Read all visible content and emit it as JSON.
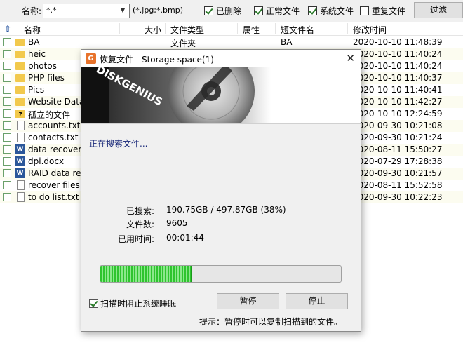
{
  "toolbar": {
    "name_label": "名称:",
    "name_value": "*.*",
    "ext_hint": "(*.jpg;*.bmp)",
    "filters": [
      {
        "label": "已删除",
        "checked": true
      },
      {
        "label": "正常文件",
        "checked": true
      },
      {
        "label": "系统文件",
        "checked": true
      },
      {
        "label": "重复文件",
        "checked": false
      }
    ],
    "filter_button": "过滤"
  },
  "columns": [
    "名称",
    "大小",
    "文件类型",
    "属性",
    "短文件名",
    "修改时间"
  ],
  "files": [
    {
      "name": "BA",
      "type": "文件夹",
      "short": "BA",
      "time": "2020-10-10 11:48:39",
      "icon": "folder-icon"
    },
    {
      "name": "heic",
      "type": "",
      "short": "",
      "time": "2020-10-10 11:40:24",
      "icon": "folder-icon"
    },
    {
      "name": "photos",
      "type": "",
      "short": "",
      "time": "2020-10-10 11:40:24",
      "icon": "folder-icon"
    },
    {
      "name": "PHP files",
      "type": "",
      "short": "",
      "time": "2020-10-10 11:40:37",
      "icon": "folder-icon"
    },
    {
      "name": "Pics",
      "type": "",
      "short": "",
      "time": "2020-10-10 11:40:41",
      "icon": "folder-icon"
    },
    {
      "name": "Website Data",
      "type": "",
      "short": "",
      "time": "2020-10-10 11:42:27",
      "icon": "folder-icon"
    },
    {
      "name": "孤立的文件",
      "type": "",
      "short": "",
      "time": "2020-10-10 12:24:59",
      "icon": "orphan-folder-icon"
    },
    {
      "name": "accounts.txt",
      "type": "",
      "short": "",
      "time": "2020-09-30 10:21:08",
      "icon": "text-file-icon"
    },
    {
      "name": "contacts.txt",
      "type": "",
      "short": "",
      "time": "2020-09-30 10:21:24",
      "icon": "text-file-icon"
    },
    {
      "name": "data recovery",
      "type": "",
      "short": "",
      "time": "2020-08-11 15:50:27",
      "icon": "word-file-icon"
    },
    {
      "name": "dpi.docx",
      "type": "",
      "short": "",
      "time": "2020-07-29 17:28:38",
      "icon": "word-file-icon"
    },
    {
      "name": "RAID data re",
      "type": "",
      "short": "",
      "time": "2020-09-30 10:21:57",
      "icon": "word-file-icon"
    },
    {
      "name": "recover files",
      "type": "",
      "short": "",
      "time": "2020-08-11 15:52:58",
      "icon": "text-file-icon"
    },
    {
      "name": "to do list.txt",
      "type": "",
      "short": "",
      "time": "2020-09-30 10:22:23",
      "icon": "text-file-icon"
    }
  ],
  "dialog": {
    "title": "恢复文件 - Storage space(1)",
    "brand": "DISKGENIUS",
    "status": "正在搜索文件...",
    "searched_label": "已搜索:",
    "searched_value": "190.75GB / 497.87GB (38%)",
    "progress": 0.38,
    "files_label": "文件数:",
    "files_value": "9605",
    "elapsed_label": "已用时间:",
    "elapsed_value": "00:01:44",
    "prevent_sleep_label": "扫描时阻止系统睡眠",
    "prevent_sleep_checked": true,
    "pause_button": "暂停",
    "stop_button": "停止",
    "tip": "提示：暂停时可以复制扫描到的文件。"
  }
}
